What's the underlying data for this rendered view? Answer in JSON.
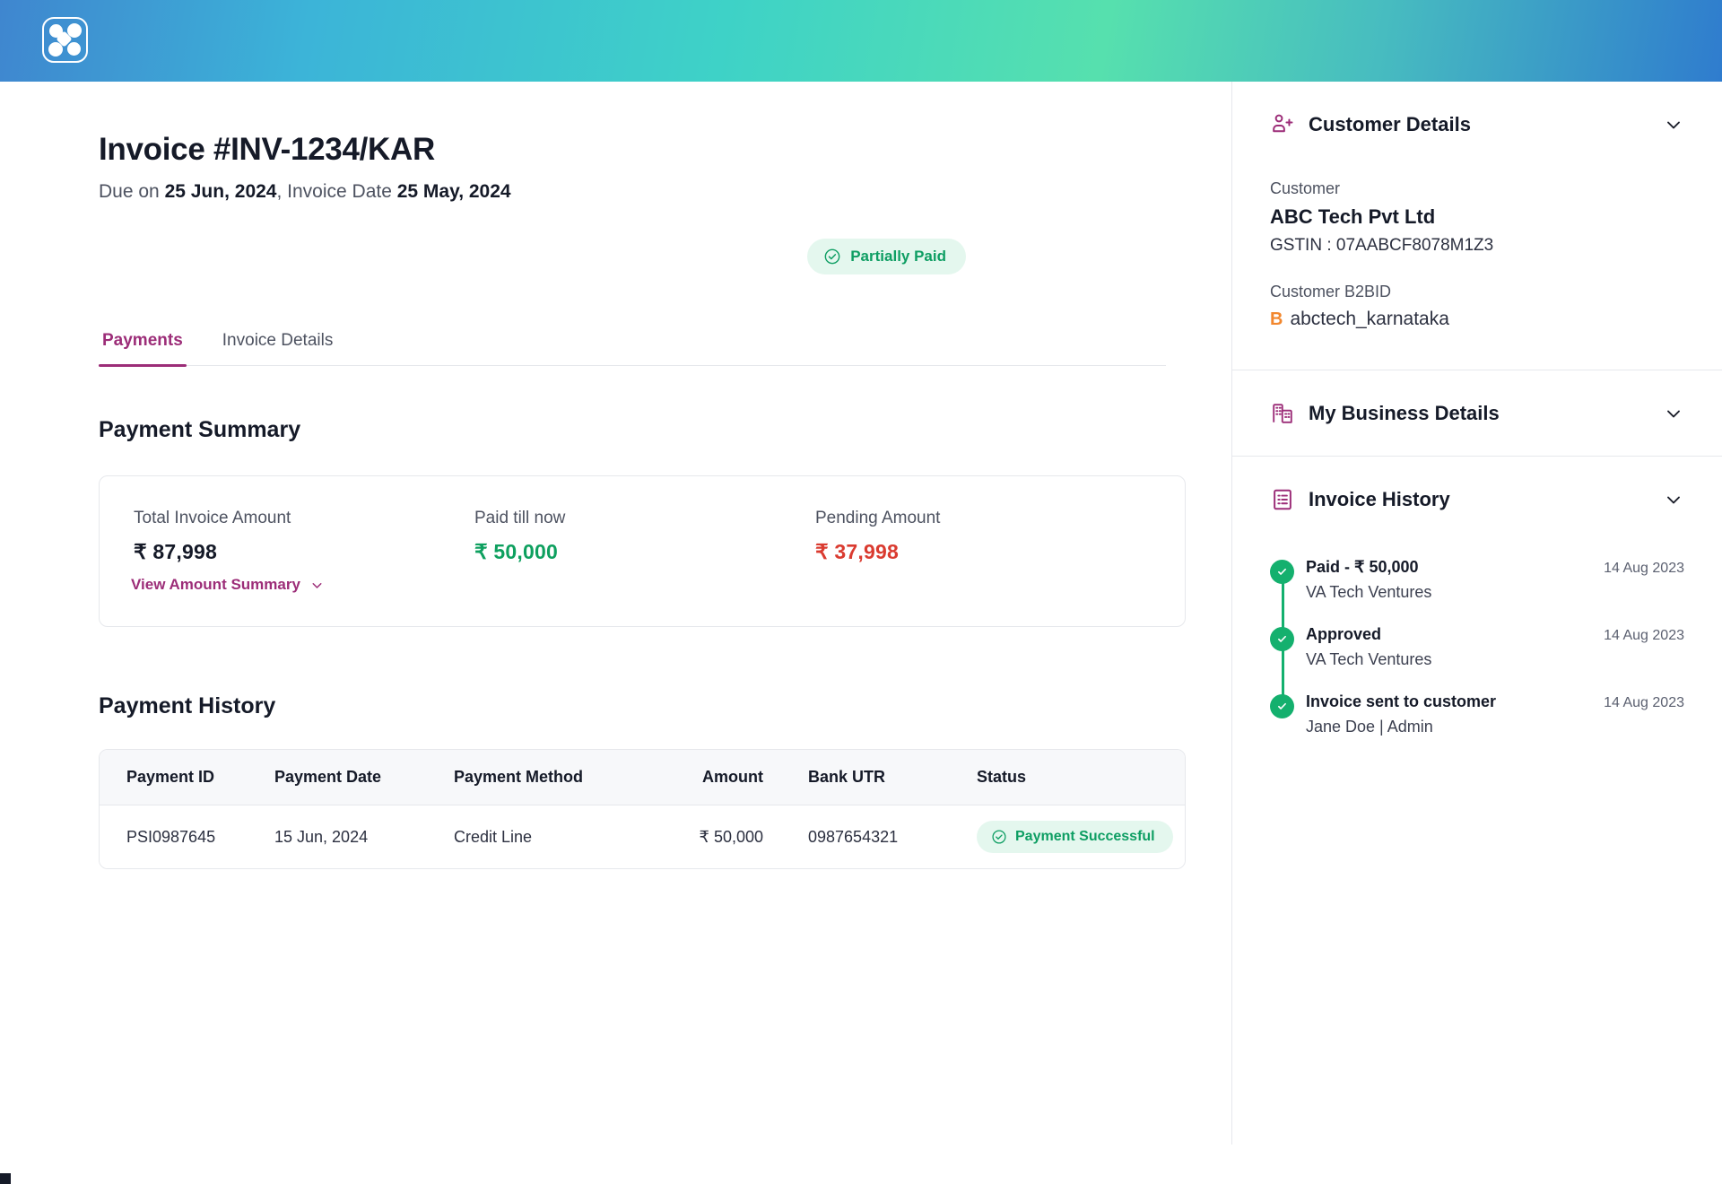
{
  "brand": {
    "logo_icon": "app-logo-icon",
    "gradient": [
      "#3f86cf",
      "#3ed2c7",
      "#56e0ae",
      "#2f7cce"
    ]
  },
  "invoice": {
    "title": "Invoice #INV-1234/KAR",
    "due_prefix": "Due on ",
    "due_date": "25 Jun, 2024",
    "invoice_date_prefix": ", Invoice Date ",
    "invoice_date": "25 May, 2024",
    "status_label": "Partially Paid",
    "status_color": "#0e9e63",
    "status_bg": "#e4f7ee",
    "status_icon": "check-circle-icon"
  },
  "tabs": [
    {
      "label": "Payments",
      "active": true
    },
    {
      "label": "Invoice Details",
      "active": false
    }
  ],
  "summary": {
    "section_title": "Payment Summary",
    "total": {
      "label": "Total Invoice Amount",
      "value": "₹ 87,998"
    },
    "paid": {
      "label": "Paid till now",
      "value": "₹ 50,000",
      "color": "#0ea05f"
    },
    "pending": {
      "label": "Pending Amount",
      "value": "₹ 37,998",
      "color": "#da3b30"
    },
    "view_link": "View Amount Summary",
    "view_link_icon": "chevron-down-icon",
    "link_color": "#9c2d78"
  },
  "history": {
    "section_title": "Payment History",
    "columns": [
      "Payment ID",
      "Payment Date",
      "Payment Method",
      "Amount",
      "Bank UTR",
      "Status"
    ],
    "rows": [
      {
        "payment_id": "PSI0987645",
        "payment_date": "15 Jun, 2024",
        "payment_method": "Credit Line",
        "amount": "₹ 50,000",
        "bank_utr": "0987654321",
        "status": "Payment Successful",
        "status_icon": "check-circle-icon"
      }
    ]
  },
  "sidebar": {
    "customer_panel": {
      "title": "Customer Details",
      "icon": "user-plus-icon",
      "chevron": "chevron-down-icon",
      "customer_label": "Customer",
      "customer_name": "ABC Tech Pvt Ltd",
      "gstin": "GSTIN : 07AABCF8078M1Z3",
      "b2bid_label": "Customer B2BID",
      "b2bid_badge": "B",
      "b2bid_value": "abctech_karnataka"
    },
    "business_panel": {
      "title": "My Business Details",
      "icon": "building-icon",
      "chevron": "chevron-down-icon"
    },
    "invoice_history_panel": {
      "title": "Invoice History",
      "icon": "document-list-icon",
      "chevron": "chevron-down-icon",
      "events": [
        {
          "title": "Paid - ₹ 50,000",
          "subtitle": "VA Tech Ventures",
          "date": "14 Aug 2023"
        },
        {
          "title": "Approved",
          "subtitle": "VA Tech Ventures",
          "date": "14 Aug 2023"
        },
        {
          "title": "Invoice sent to customer",
          "subtitle": "Jane Doe | Admin",
          "date": "14 Aug 2023"
        }
      ]
    }
  }
}
